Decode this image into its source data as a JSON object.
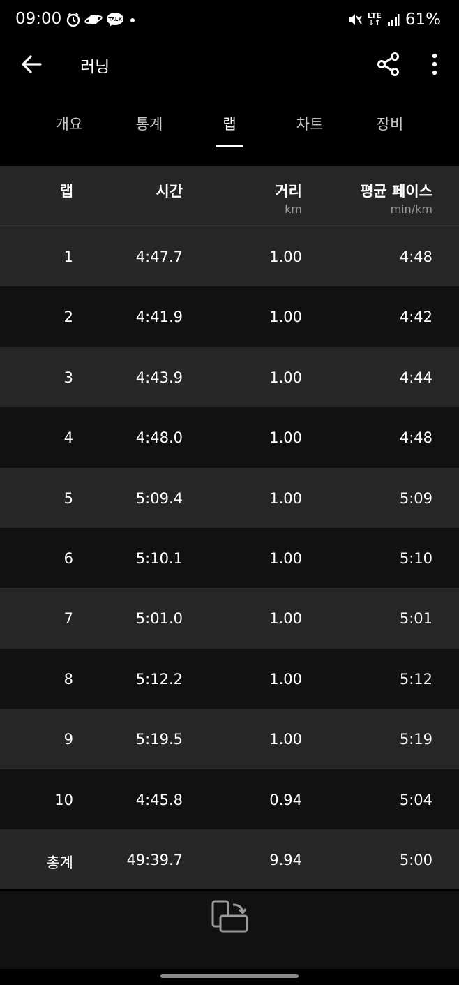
{
  "status_bar": {
    "time": "09:00",
    "battery": "61%",
    "network": "LTE",
    "icons": [
      "alarm-icon",
      "saturn-icon",
      "kakaotalk-icon",
      "dot-icon",
      "mute-icon",
      "lte-icon",
      "signal-icon"
    ]
  },
  "app_bar": {
    "title": "러닝"
  },
  "tabs": [
    {
      "label": "개요"
    },
    {
      "label": "통계"
    },
    {
      "label": "랩",
      "active": true
    },
    {
      "label": "차트"
    },
    {
      "label": "장비"
    }
  ],
  "table": {
    "headers": [
      {
        "label": "랩",
        "unit": ""
      },
      {
        "label": "시간",
        "unit": ""
      },
      {
        "label": "거리",
        "unit": "km"
      },
      {
        "label": "평균 페이스",
        "unit": "min/km"
      }
    ],
    "rows": [
      [
        "1",
        "4:47.7",
        "1.00",
        "4:48"
      ],
      [
        "2",
        "4:41.9",
        "1.00",
        "4:42"
      ],
      [
        "3",
        "4:43.9",
        "1.00",
        "4:44"
      ],
      [
        "4",
        "4:48.0",
        "1.00",
        "4:48"
      ],
      [
        "5",
        "5:09.4",
        "1.00",
        "5:09"
      ],
      [
        "6",
        "5:10.1",
        "1.00",
        "5:10"
      ],
      [
        "7",
        "5:01.0",
        "1.00",
        "5:01"
      ],
      [
        "8",
        "5:12.2",
        "1.00",
        "5:12"
      ],
      [
        "9",
        "5:19.5",
        "1.00",
        "5:19"
      ],
      [
        "10",
        "4:45.8",
        "0.94",
        "5:04"
      ],
      [
        "총계",
        "49:39.7",
        "9.94",
        "5:00"
      ]
    ]
  },
  "colors": {
    "background": "#000000",
    "row_light": "#262626",
    "row_dark": "#111111",
    "unit_text": "#9a9a9a"
  }
}
